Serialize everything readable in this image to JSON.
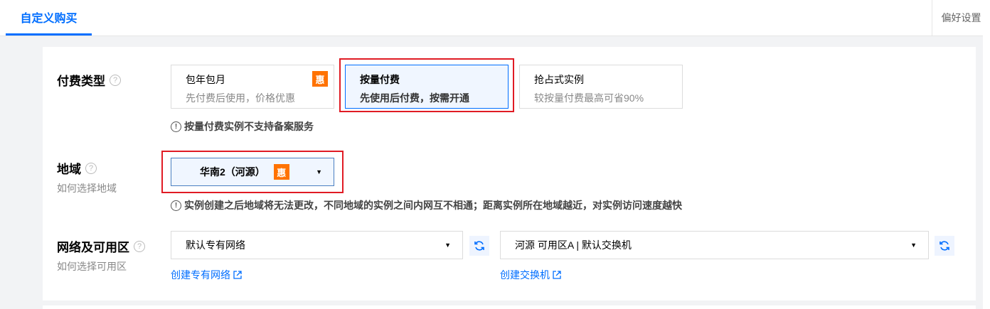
{
  "tabs": {
    "active": "自定义购买",
    "preference": "偏好设置"
  },
  "billing": {
    "label": "付费类型",
    "options": [
      {
        "title": "包年包月",
        "desc": "先付费后使用，价格优惠",
        "badge": "惠"
      },
      {
        "title": "按量付费",
        "desc": "先使用后付费，按需开通",
        "selected": true
      },
      {
        "title": "抢占式实例",
        "desc": "较按量付费最高可省90%"
      }
    ],
    "note": "按量付费实例不支持备案服务"
  },
  "region": {
    "label": "地域",
    "help_link": "如何选择地域",
    "selected": "华南2（河源）",
    "badge": "惠",
    "note": "实例创建之后地域将无法更改，不同地域的实例之间内网互不相通；距离实例所在地域越近，对实例访问速度越快"
  },
  "network": {
    "label": "网络及可用区",
    "help_link": "如何选择可用区",
    "vpc_selected": "默认专有网络",
    "zone_selected": "河源 可用区A | 默认交换机",
    "create_vpc": "创建专有网络",
    "create_switch": "创建交换机"
  },
  "icons": {
    "help": "question-circle-icon",
    "warn": "info-circle-icon",
    "refresh": "refresh-icon",
    "external": "external-link-icon",
    "caret": "caret-down-icon"
  },
  "colors": {
    "accent": "#006eff",
    "badge": "#ff7200",
    "highlight_box": "#e01b24"
  }
}
